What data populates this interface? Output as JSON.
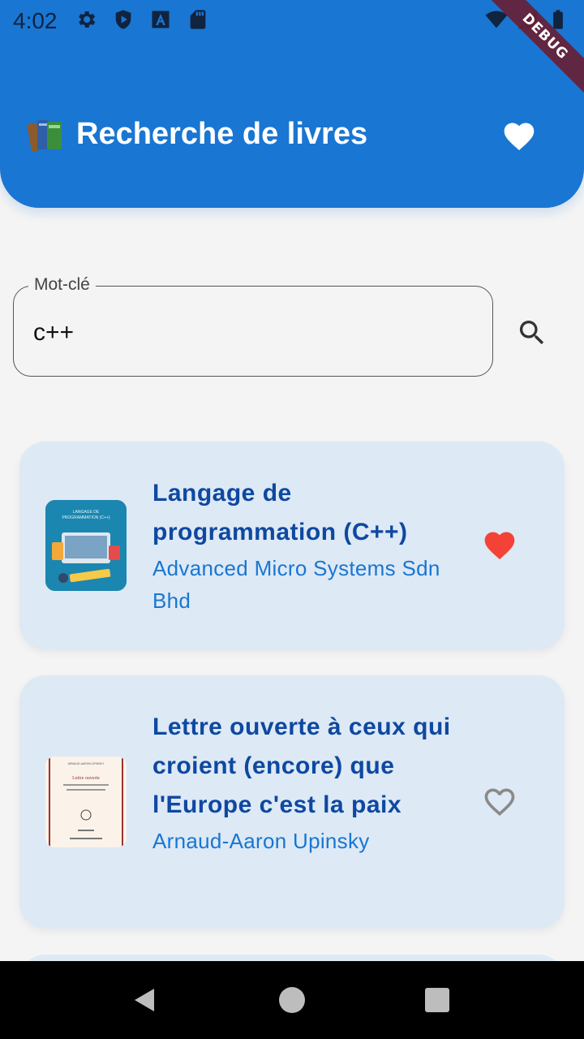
{
  "status_bar": {
    "time": "4:02",
    "icons": [
      "settings-icon",
      "shield-icon",
      "font-a-icon",
      "sd-card-icon"
    ],
    "right_icons": [
      "wifi-icon",
      "signal-icon",
      "battery-icon"
    ]
  },
  "debug_banner": "DEBUG",
  "header": {
    "title": "Recherche de livres",
    "title_icon": "books-icon",
    "favorites_icon": "heart-icon",
    "color": "#1976d2"
  },
  "search": {
    "label": "Mot-clé",
    "value": "c++",
    "button_icon": "search-icon"
  },
  "results": [
    {
      "title": "Langage de programmation (C++)",
      "author": "Advanced Micro Systems Sdn Bhd",
      "favorite": true,
      "cover_text": "LANGAGE DE PROGRAMMATION (C++)"
    },
    {
      "title": "Lettre ouverte à ceux qui croient (encore) que l'Europe c'est la paix",
      "author": "Arnaud-Aaron Upinsky",
      "favorite": false,
      "cover_text": "Lettre ouverte"
    }
  ],
  "colors": {
    "accent": "#1976d2",
    "title_text": "#0e48a1",
    "card_bg": "#dde9f5",
    "favorite_on": "#f44336",
    "favorite_off": "#8a8a8a"
  },
  "nav": [
    "back-icon",
    "home-icon",
    "recents-icon"
  ]
}
